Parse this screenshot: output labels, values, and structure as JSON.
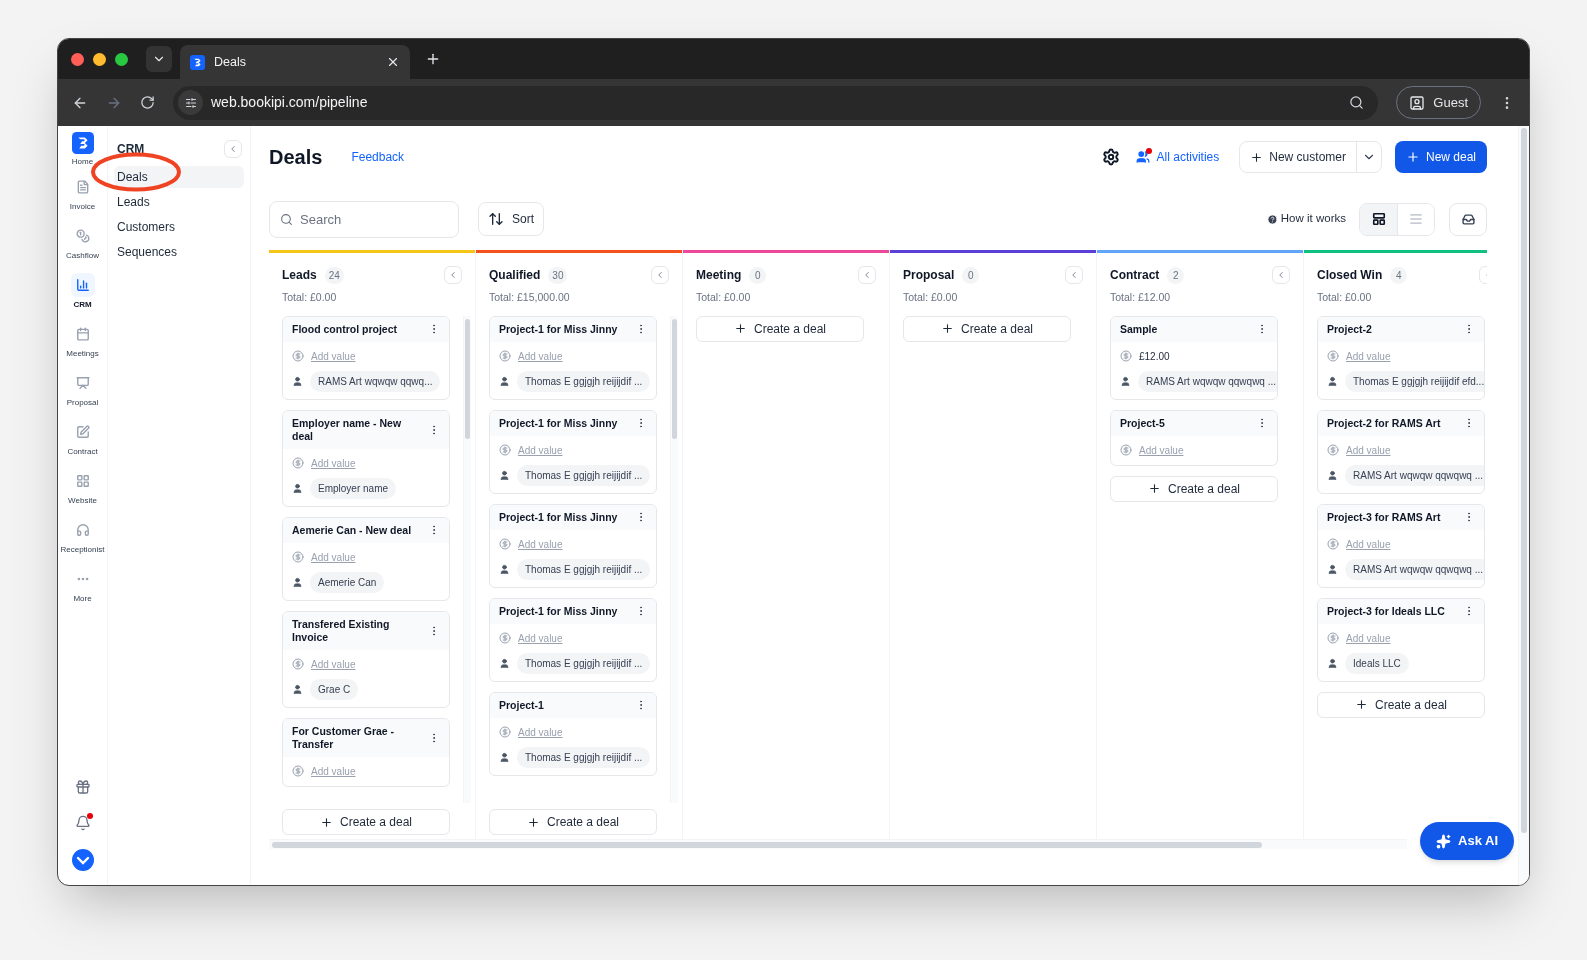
{
  "browser": {
    "tab_title": "Deals",
    "url": "web.bookipi.com/pipeline",
    "profile": "Guest"
  },
  "rail": {
    "items": [
      {
        "label": "Home",
        "selected": false
      },
      {
        "label": "Invoice",
        "selected": false
      },
      {
        "label": "Cashflow",
        "selected": false
      },
      {
        "label": "CRM",
        "selected": true
      },
      {
        "label": "Meetings",
        "selected": false
      },
      {
        "label": "Proposal",
        "selected": false
      },
      {
        "label": "Contract",
        "selected": false
      },
      {
        "label": "Website",
        "selected": false
      },
      {
        "label": "Receptionist",
        "selected": false
      },
      {
        "label": "More",
        "selected": false
      }
    ],
    "notifications_unread": true
  },
  "subnav": {
    "title": "CRM",
    "items": [
      {
        "label": "Deals",
        "selected": true
      },
      {
        "label": "Leads",
        "selected": false
      },
      {
        "label": "Customers",
        "selected": false
      },
      {
        "label": "Sequences",
        "selected": false
      }
    ]
  },
  "header": {
    "title": "Deals",
    "feedback": "Feedback",
    "all_activities": "All activities",
    "activities_unread": true,
    "new_customer": "New customer",
    "new_deal": "New deal"
  },
  "toolbar": {
    "search_placeholder": "Search",
    "sort": "Sort",
    "how_it_works": "How it works",
    "views": [
      {
        "kind": "board",
        "selected": true
      },
      {
        "kind": "list",
        "selected": false
      }
    ]
  },
  "columns": [
    {
      "name": "Leads",
      "count": "24",
      "total": "Total: £0.00",
      "color": "#f5c518",
      "scrollable": true,
      "create": "Create a deal",
      "cards": [
        {
          "title": "Flood control project",
          "value": "Add value",
          "value_empty": true,
          "contact": "RAMS Art wqwqw qqwq..."
        },
        {
          "title": "Employer name - New deal",
          "value": "Add value",
          "value_empty": true,
          "contact": "Employer name"
        },
        {
          "title": "Aemerie Can - New deal",
          "value": "Add value",
          "value_empty": true,
          "contact": "Aemerie Can"
        },
        {
          "title": "Transfered Existing Invoice",
          "value": "Add value",
          "value_empty": true,
          "contact": "Grae C"
        },
        {
          "title": "For Customer Grae - Transfer",
          "value": "Add value",
          "value_empty": true
        }
      ]
    },
    {
      "name": "Qualified",
      "count": "30",
      "total": "Total: £15,000.00",
      "color": "#f4511e",
      "scrollable": true,
      "create": "Create a deal",
      "cards": [
        {
          "title": "Project-1 for Miss Jinny",
          "value": "Add value",
          "value_empty": true,
          "contact": "Thomas E ggjgjh reijijdif ..."
        },
        {
          "title": "Project-1 for Miss Jinny",
          "value": "Add value",
          "value_empty": true,
          "contact": "Thomas E ggjgjh reijijdif ..."
        },
        {
          "title": "Project-1 for Miss Jinny",
          "value": "Add value",
          "value_empty": true,
          "contact": "Thomas E ggjgjh reijijdif ..."
        },
        {
          "title": "Project-1 for Miss Jinny",
          "value": "Add value",
          "value_empty": true,
          "contact": "Thomas E ggjgjh reijijdif ..."
        },
        {
          "title": "Project-1",
          "value": "Add value",
          "value_empty": true,
          "contact": "Thomas E ggjgjh reijijdif ..."
        }
      ]
    },
    {
      "name": "Meeting",
      "count": "0",
      "total": "Total: £0.00",
      "color": "#ec4899",
      "scrollable": false,
      "create": "Create a deal"
    },
    {
      "name": "Proposal",
      "count": "0",
      "total": "Total: £0.00",
      "color": "#5b3fd6",
      "scrollable": false,
      "create": "Create a deal"
    },
    {
      "name": "Contract",
      "count": "2",
      "total": "Total: £12.00",
      "color": "#60a5fa",
      "scrollable": false,
      "create": "Create a deal",
      "cards": [
        {
          "title": "Sample",
          "value": "£12.00",
          "value_empty": false,
          "contact": "RAMS Art wqwqw qqwqwq ..."
        },
        {
          "title": "Project-5",
          "value": "Add value",
          "value_empty": true
        }
      ]
    },
    {
      "name": "Closed Win",
      "count": "4",
      "total": "Total: £0.00",
      "color": "#10c080",
      "scrollable": false,
      "create": "Create a deal",
      "cards": [
        {
          "title": "Project-2",
          "value": "Add value",
          "value_empty": true,
          "contact": "Thomas E ggjgjh reijijdif efd..."
        },
        {
          "title": "Project-2 for RAMS Art",
          "value": "Add value",
          "value_empty": true,
          "contact": "RAMS Art wqwqw qqwqwq ..."
        },
        {
          "title": "Project-3 for RAMS Art",
          "value": "Add value",
          "value_empty": true,
          "contact": "RAMS Art wqwqw qqwqwq ..."
        },
        {
          "title": "Project-3 for Ideals LLC",
          "value": "Add value",
          "value_empty": true,
          "contact": "Ideals LLC"
        }
      ]
    }
  ],
  "ask_ai": "Ask AI"
}
